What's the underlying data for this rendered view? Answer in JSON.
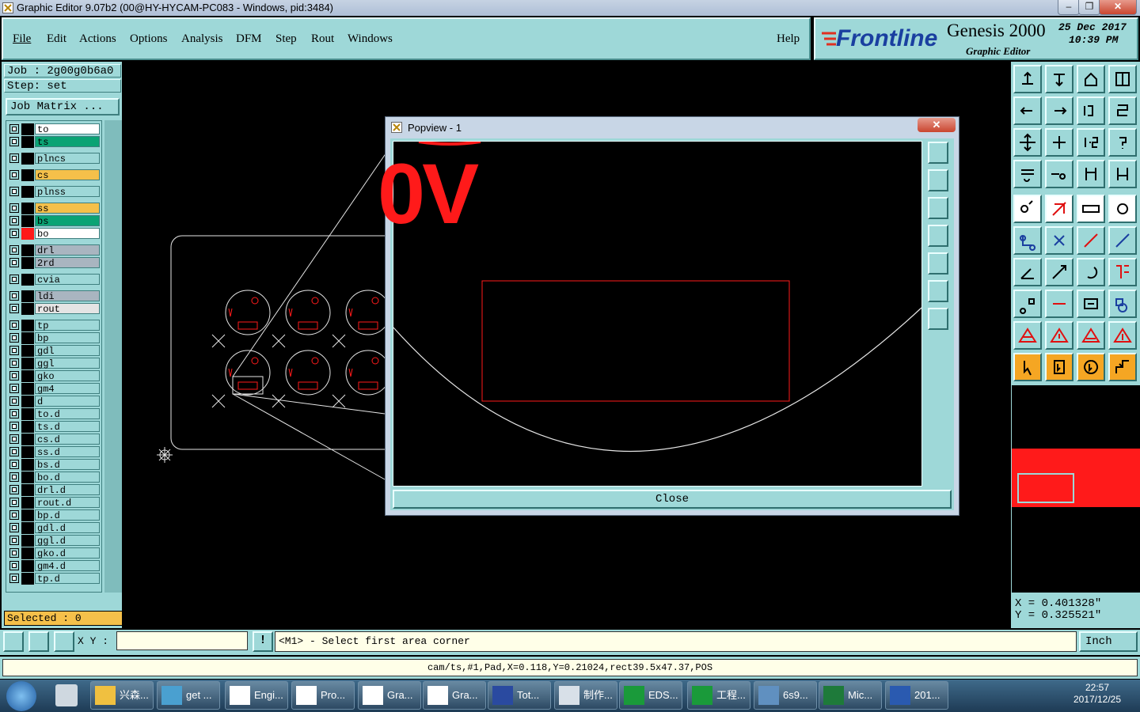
{
  "window": {
    "title": "Graphic Editor 9.07b2 (00@HY-HYCAM-PC083 - Windows, pid:3484)"
  },
  "menu": {
    "items": [
      "File",
      "Edit",
      "Actions",
      "Options",
      "Analysis",
      "DFM",
      "Step",
      "Rout",
      "Windows"
    ],
    "help": "Help"
  },
  "brand": {
    "logo": "Frontline",
    "product": "Genesis 2000",
    "subtitle": "Graphic Editor",
    "date": "25 Dec 2017",
    "time": "10:39 PM"
  },
  "job": {
    "job_label": "Job : 2g00g0b6a0",
    "step_label": "Step: set",
    "matrix_button": "Job Matrix ..."
  },
  "layers": [
    {
      "name": "to",
      "color": "#ffffff"
    },
    {
      "name": "ts",
      "color": "#0aa374"
    },
    {
      "name": "plncs",
      "color": "#9ed8d8"
    },
    {
      "name": "cs",
      "color": "#f5c04a"
    },
    {
      "name": "plnss",
      "color": "#9ed8d8"
    },
    {
      "name": "ss",
      "color": "#f5c04a"
    },
    {
      "name": "bs",
      "color": "#0aa374"
    },
    {
      "name": "bo",
      "color": "#ffffff"
    },
    {
      "name": "drl",
      "color": "#a9b5c0"
    },
    {
      "name": "2rd",
      "color": "#a9b5c0"
    },
    {
      "name": "cvia",
      "color": "#9ed8d8"
    },
    {
      "name": "ldi",
      "color": "#a9b5c0"
    },
    {
      "name": "rout",
      "color": "#e4e4e4"
    },
    {
      "name": "tp",
      "color": "#9ed8d8"
    },
    {
      "name": "bp",
      "color": "#9ed8d8"
    },
    {
      "name": "gdl",
      "color": "#9ed8d8"
    },
    {
      "name": "ggl",
      "color": "#9ed8d8"
    },
    {
      "name": "gko",
      "color": "#9ed8d8"
    },
    {
      "name": "gm4",
      "color": "#9ed8d8"
    },
    {
      "name": "d",
      "color": "#9ed8d8"
    },
    {
      "name": "to.d",
      "color": "#9ed8d8"
    },
    {
      "name": "ts.d",
      "color": "#9ed8d8"
    },
    {
      "name": "cs.d",
      "color": "#9ed8d8"
    },
    {
      "name": "ss.d",
      "color": "#9ed8d8"
    },
    {
      "name": "bs.d",
      "color": "#9ed8d8"
    },
    {
      "name": "bo.d",
      "color": "#9ed8d8"
    },
    {
      "name": "drl.d",
      "color": "#9ed8d8"
    },
    {
      "name": "rout.d",
      "color": "#9ed8d8"
    },
    {
      "name": "bp.d",
      "color": "#9ed8d8"
    },
    {
      "name": "gdl.d",
      "color": "#9ed8d8"
    },
    {
      "name": "ggl.d",
      "color": "#9ed8d8"
    },
    {
      "name": "gko.d",
      "color": "#9ed8d8"
    },
    {
      "name": "gm4.d",
      "color": "#9ed8d8"
    },
    {
      "name": "tp.d",
      "color": "#9ed8d8"
    }
  ],
  "selected": "Selected : 0",
  "popview": {
    "title": "Popview - 1",
    "close_label": "Close",
    "close_x": "✕",
    "silk_text": "0V"
  },
  "coords": {
    "x": "X = 0.401328\"",
    "y": "Y = 0.325521\""
  },
  "command": {
    "xy_label": "X Y :",
    "message": "<M1> - Select first area corner",
    "unit": "Inch"
  },
  "status": "cam/ts,#1,Pad,X=0.118,Y=0.21024,rect39.5x47.37,POS",
  "taskbar": {
    "tasks": [
      "兴森...",
      "get ...",
      "Engi...",
      "Pro...",
      "Gra...",
      "Gra...",
      "Tot...",
      "制作...",
      "EDS...",
      "工程...",
      "6s9...",
      "Mic...",
      "201..."
    ],
    "clock_time": "22:57",
    "clock_date": "2017/12/25"
  },
  "colors": {
    "panel": "#9ed8d8",
    "silk_red": "#ff1a1a",
    "highlight": "#f5c04a"
  }
}
